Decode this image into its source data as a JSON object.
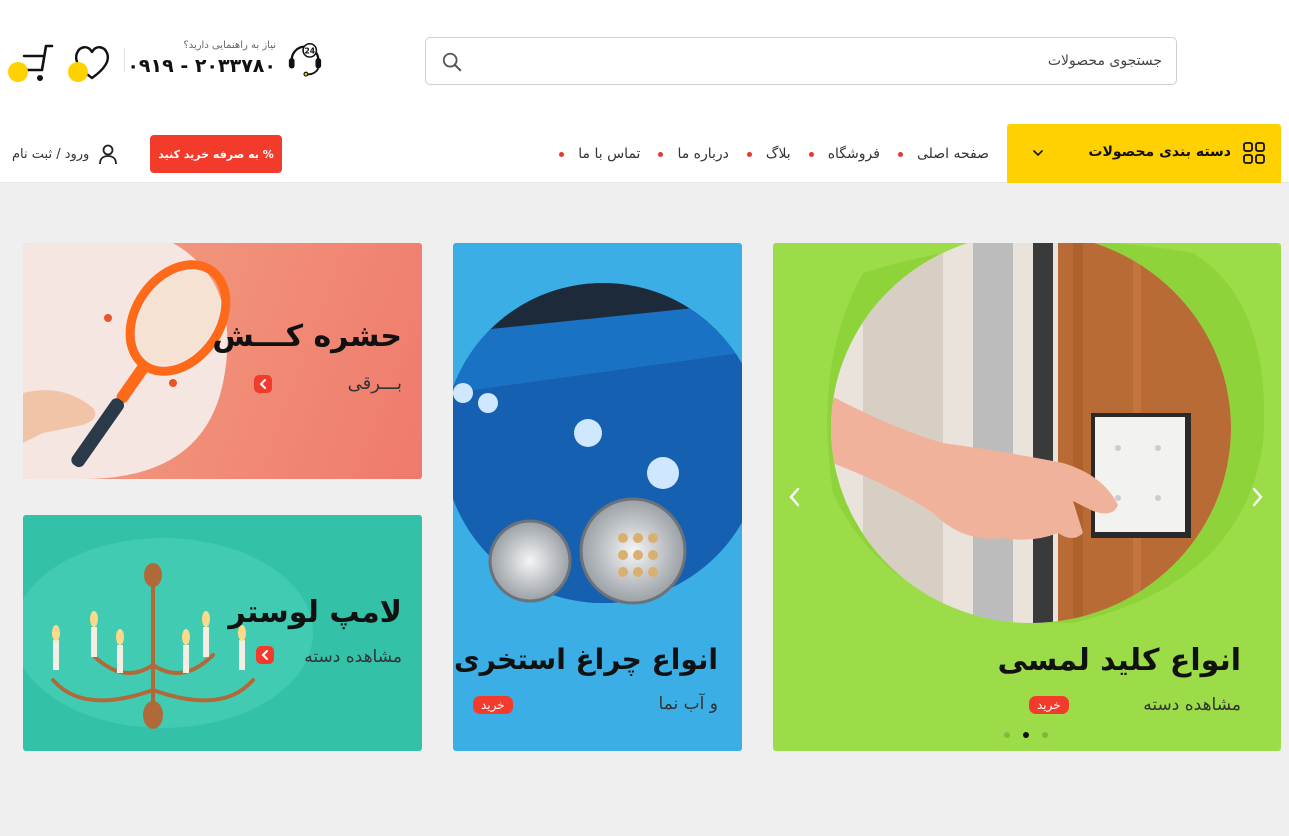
{
  "search": {
    "placeholder": "جستجوی محصولات"
  },
  "support": {
    "hint": "نیاز به راهنمایی دارید؟",
    "phone": "۰۹۱۹ - ۲۰۳۳۷۸۰",
    "icon_badge": "24"
  },
  "categories_button": {
    "label": "دسته بندی محصولات"
  },
  "nav": {
    "items": [
      {
        "label": "صفحه اصلی"
      },
      {
        "label": "فروشگاه"
      },
      {
        "label": "بلاگ"
      },
      {
        "label": "درباره ما"
      },
      {
        "label": "تماس با ما"
      }
    ]
  },
  "cta_button": {
    "label": "% به صرفه خرید کنید"
  },
  "login": {
    "label": "ورود / ثبت نام"
  },
  "banners": {
    "touch_switch": {
      "title": "انواع کلید لمسی",
      "subtitle": "مشاهده دسته",
      "tag": "خرید"
    },
    "pool_light": {
      "title": "انواع چراغ استخری",
      "subtitle": "و آب نما",
      "tag": "خرید"
    },
    "bug_zapper": {
      "title": "حشره کـــش",
      "subtitle": "بـــرقی"
    },
    "chandelier": {
      "title": "لامپ لوستر",
      "subtitle": "مشاهده دسته"
    }
  },
  "slider": {
    "total_slides": 3,
    "active_slide": 2
  },
  "colors": {
    "accent_yellow": "#ffd100",
    "accent_red": "#f33b2c",
    "banner_green": "#9bdc48",
    "banner_blue": "#3aaee5",
    "banner_teal": "#33c1a7",
    "banner_coral": "#f07a6c"
  },
  "icons": {
    "search": "search-icon",
    "support": "headset-24-icon",
    "wishlist": "heart-icon",
    "cart": "cart-icon",
    "categories": "grid-icon",
    "dropdown": "chevron-down-icon",
    "user": "user-icon"
  }
}
